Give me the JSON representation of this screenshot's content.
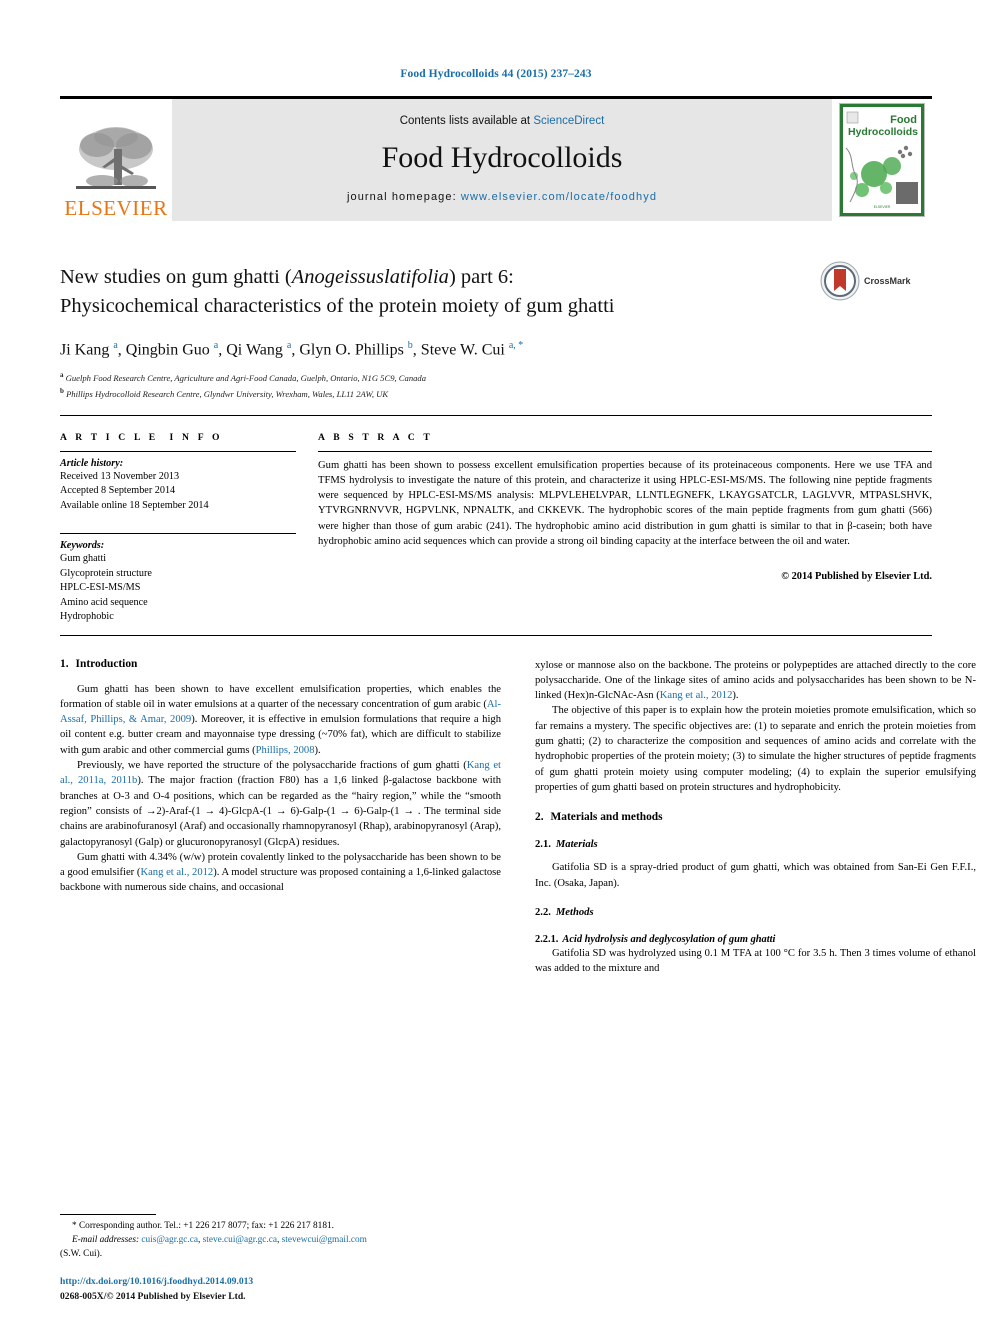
{
  "running_head": "Food Hydrocolloids 44 (2015) 237–243",
  "masthead": {
    "publisher": "ELSEVIER",
    "contents_prefix": "Contents lists available at ",
    "contents_link": "ScienceDirect",
    "journal_title": "Food Hydrocolloids",
    "homepage_prefix": "journal homepage: ",
    "homepage_url": "www.elsevier.com/locate/foodhyd",
    "cover_title_line1": "Food",
    "cover_title_line2": "Hydrocolloids",
    "accent_color": "#1a6ea8",
    "elsevier_orange": "#e87511",
    "band_gray": "#e6e6e6"
  },
  "title": {
    "line1_a": "New studies on gum ghatti (",
    "line1_italic": "Anogeissuslatifolia",
    "line1_b": ") part 6:",
    "line2": "Physicochemical characteristics of the protein moiety of gum ghatti",
    "crossmark_label": "CrossMark"
  },
  "authors": {
    "list": "Ji Kang a, Qingbin Guo a, Qi Wang a, Glyn O. Phillips b, Steve W. Cui a, *",
    "affiliation_a": "Guelph Food Research Centre, Agriculture and Agri-Food Canada, Guelph, Ontario, N1G 5C9, Canada",
    "affiliation_b": "Phillips Hydrocolloid Research Centre, Glyndwr University, Wrexham, Wales, LL11 2AW, UK",
    "marker_a": "a",
    "marker_b": "b"
  },
  "article_info": {
    "heading": "ARTICLE INFO",
    "history_label": "Article history:",
    "history": [
      "Received 13 November 2013",
      "Accepted 8 September 2014",
      "Available online 18 September 2014"
    ],
    "keywords_label": "Keywords:",
    "keywords": [
      "Gum ghatti",
      "Glycoprotein structure",
      "HPLC-ESI-MS/MS",
      "Amino acid sequence",
      "Hydrophobic"
    ]
  },
  "abstract": {
    "heading": "ABSTRACT",
    "text": "Gum ghatti has been shown to possess excellent emulsification properties because of its proteinaceous components. Here we use TFA and TFMS hydrolysis to investigate the nature of this protein, and characterize it using HPLC-ESI-MS/MS. The following nine peptide fragments were sequenced by HPLC-ESI-MS/MS analysis: MLPVLEHELVPAR, LLNTLEGNEFK, LKAYGSATCLR, LAGLVVR, MTPASLSHVK, YTVRGNRNVVR, HGPVLNK, NPNALTK, and CKKEVK. The hydrophobic scores of the main peptide fragments from gum ghatti (566) were higher than those of gum arabic (241). The hydrophobic amino acid distribution in gum ghatti is similar to that in β-casein; both have hydrophobic amino acid sequences which can provide a strong oil binding capacity at the interface between the oil and water.",
    "copyright": "© 2014 Published by Elsevier Ltd."
  },
  "sections": {
    "intro_num": "1.",
    "intro_title": "Introduction",
    "methods_num": "2.",
    "methods_title": "Materials and methods",
    "materials_num": "2.1.",
    "materials_title": "Materials",
    "methods_sub_num": "2.2.",
    "methods_sub_title": "Methods",
    "acid_num": "2.2.1.",
    "acid_title": "Acid hydrolysis and deglycosylation of gum ghatti"
  },
  "body": {
    "left_p1_a": "Gum ghatti has been shown to have excellent emulsification properties, which enables the formation of stable oil in water emulsions at a quarter of the necessary concentration of gum arabic (",
    "left_p1_ref1": "Al-Assaf, Phillips, & Amar, 2009",
    "left_p1_b": "). Moreover, it is effective in emulsion formulations that require a high oil content e.g. butter cream and mayonnaise type dressing (~70% fat), which are difficult to stabilize with gum arabic and other commercial gums (",
    "left_p1_ref2": "Phillips, 2008",
    "left_p1_c": ").",
    "left_p2_a": "Previously, we have reported the structure of the polysaccharide fractions of gum ghatti (",
    "left_p2_ref1": "Kang et al., 2011a, 2011b",
    "left_p2_b": "). The major fraction (fraction F80) has a 1,6 linked β-galactose backbone with branches at O-3 and O-4 positions, which can be regarded as the “hairy region,” while the “smooth region” consists of →2)-Araf-(1 → 4)-GlcpA-(1 → 6)-Galp-(1 → 6)-Galp-(1 → . The terminal side chains are arabinofuranosyl (Araf) and occasionally rhamnopyranosyl (Rhap), arabinopyranosyl (Arap), galactopyranosyl (Galp) or glucuronopyranosyl (GlcpA) residues.",
    "left_p3_a": "Gum ghatti with 4.34% (w/w) protein covalently linked to the polysaccharide has been shown to be a good emulsifier (",
    "left_p3_ref1": "Kang et al., 2012",
    "left_p3_b": "). A model structure was proposed containing a 1,6-linked galactose backbone with numerous side chains, and occasional",
    "right_p1_a": "xylose or mannose also on the backbone. The proteins or polypeptides are attached directly to the core polysaccharide. One of the linkage sites of amino acids and polysaccharides has been shown to be N-linked (Hex)n-GlcNAc-Asn (",
    "right_p1_ref1": "Kang et al., 2012",
    "right_p1_b": ").",
    "right_p2": "The objective of this paper is to explain how the protein moieties promote emulsification, which so far remains a mystery. The specific objectives are: (1) to separate and enrich the protein moieties from gum ghatti; (2) to characterize the composition and sequences of amino acids and correlate with the hydrophobic properties of the protein moiety; (3) to simulate the higher structures of peptide fragments of gum ghatti protein moiety using computer modeling; (4) to explain the superior emulsifying properties of gum ghatti based on protein structures and hydrophobicity.",
    "right_materials_p": "Gatifolia SD is a spray-dried product of gum ghatti, which was obtained from San-Ei Gen F.F.I., Inc. (Osaka, Japan).",
    "right_acid_p": "Gatifolia SD was hydrolyzed using 0.1 M TFA at 100 °C for 3.5 h. Then 3 times volume of ethanol was added to the mixture and"
  },
  "footnote": {
    "corresponding": "* Corresponding author. Tel.: +1 226 217 8077; fax: +1 226 217 8181.",
    "email_label": "E-mail addresses:",
    "email1": "cuis@agr.gc.ca",
    "email2": "steve.cui@agr.gc.ca",
    "email3": "stevewcui@gmail.com",
    "email_suffix": "(S.W. Cui).",
    "doi": "http://dx.doi.org/10.1016/j.foodhyd.2014.09.013",
    "issn": "0268-005X/© 2014 Published by Elsevier Ltd."
  }
}
